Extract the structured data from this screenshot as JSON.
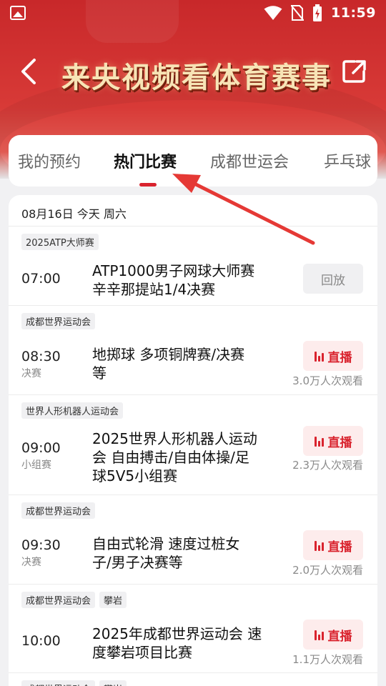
{
  "status_bar": {
    "time": "11:59"
  },
  "header": {
    "title": "来央视频看体育赛事"
  },
  "tabs": [
    "我的预约",
    "热门比赛",
    "成都世运会",
    "乒乓球"
  ],
  "active_tab": 1,
  "date_header": "08月16日 今天 周六",
  "events": [
    {
      "tags": [
        "2025ATP大师赛"
      ],
      "time": "07:00",
      "stage": "",
      "title_lines": [
        "ATP1000男子网球大师赛",
        "辛辛那提站1/4决赛"
      ],
      "button": "回放",
      "live": false,
      "viewers": ""
    },
    {
      "tags": [
        "成都世界运动会"
      ],
      "time": "08:30",
      "stage": "决赛",
      "title_lines": [
        "地掷球 多项铜牌赛/决赛",
        "等"
      ],
      "button": "直播",
      "live": true,
      "viewers": "3.0万人次观看"
    },
    {
      "tags": [
        "世界人形机器人运动会"
      ],
      "time": "09:00",
      "stage": "小组赛",
      "title_lines": [
        "2025世界人形机器人运动",
        "会 自由搏击/自由体操/足",
        "球5V5小组赛"
      ],
      "button": "直播",
      "live": true,
      "viewers": "2.3万人次观看"
    },
    {
      "tags": [
        "成都世界运动会"
      ],
      "time": "09:30",
      "stage": "决赛",
      "title_lines": [
        "自由式轮滑 速度过桩女",
        "子/男子决赛等"
      ],
      "button": "直播",
      "live": true,
      "viewers": "2.0万人次观看"
    },
    {
      "tags": [
        "成都世界运动会",
        "攀岩"
      ],
      "time": "10:00",
      "stage": "",
      "title_lines": [
        "2025年成都世界运动会 速",
        "度攀岩项目比赛"
      ],
      "button": "直播",
      "live": true,
      "viewers": "1.1万人次观看"
    },
    {
      "tags": [
        "成都世界运动会",
        "攀岩"
      ],
      "time": "",
      "stage": "",
      "title_lines": [],
      "button": "",
      "live": false,
      "viewers": ""
    }
  ],
  "colors": {
    "brand_red": "#d9232e",
    "header_red": "#c8282a",
    "title_gold": "#f7e4b6",
    "annotation_arrow": "#e53935"
  },
  "icons": [
    "image-icon",
    "wifi-icon",
    "no-sim-icon",
    "battery-charging-icon",
    "back-arrow-icon",
    "share-icon",
    "live-bars-icon"
  ]
}
